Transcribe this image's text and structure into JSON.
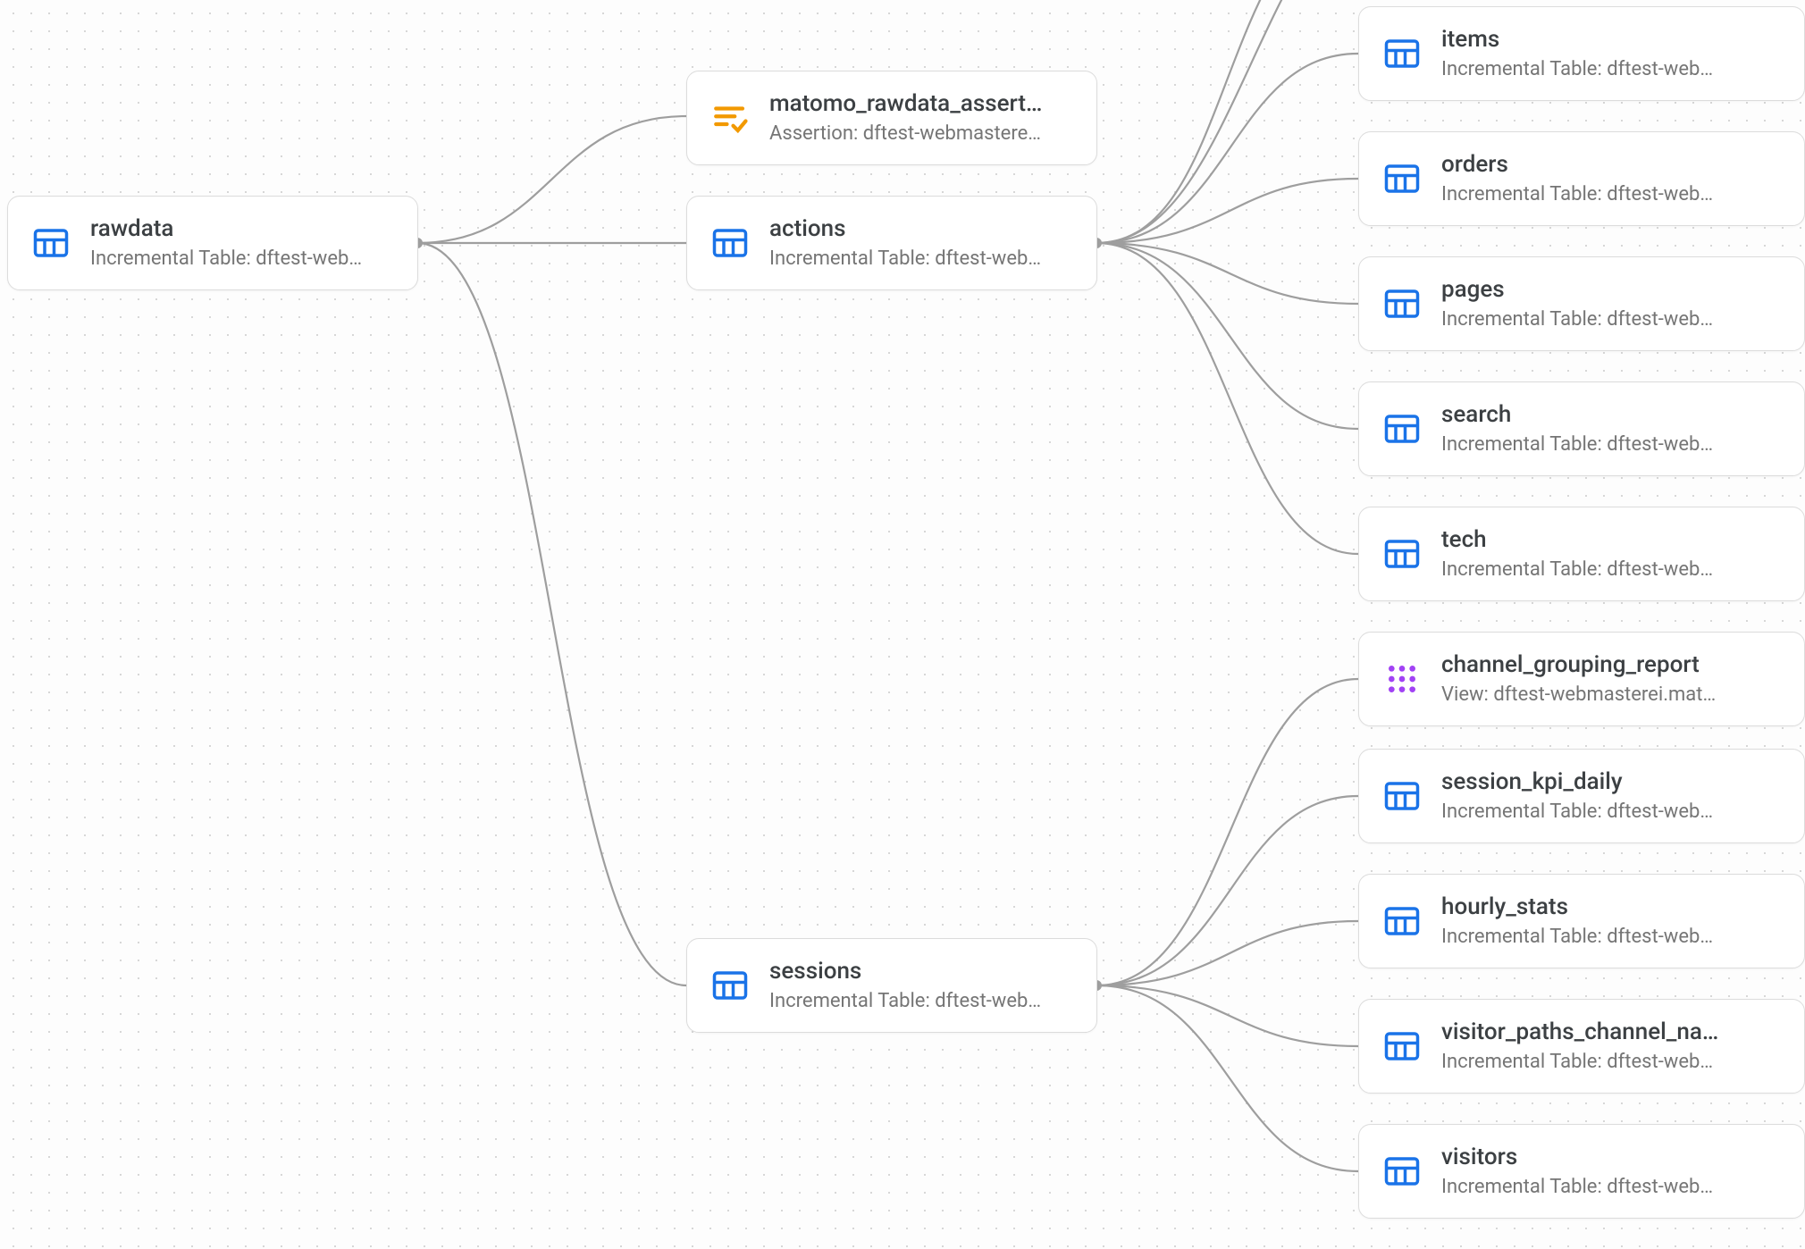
{
  "types": {
    "table": "Incremental Table: dftest-web…",
    "assertion": "Assertion: dftest-webmastere…",
    "view": "View: dftest-webmasterei.mat…"
  },
  "nodes": {
    "rawdata": {
      "title": "rawdata",
      "subtitleKey": "table"
    },
    "assert": {
      "title": "matomo_rawdata_assert…",
      "subtitleKey": "assertion"
    },
    "actions": {
      "title": "actions",
      "subtitleKey": "table"
    },
    "sessions": {
      "title": "sessions",
      "subtitleKey": "table"
    },
    "items": {
      "title": "items",
      "subtitleKey": "table"
    },
    "orders": {
      "title": "orders",
      "subtitleKey": "table"
    },
    "pages": {
      "title": "pages",
      "subtitleKey": "table"
    },
    "search": {
      "title": "search",
      "subtitleKey": "table"
    },
    "tech": {
      "title": "tech",
      "subtitleKey": "table"
    },
    "channel": {
      "title": "channel_grouping_report",
      "subtitleKey": "view"
    },
    "kpi": {
      "title": "session_kpi_daily",
      "subtitleKey": "table"
    },
    "hourly": {
      "title": "hourly_stats",
      "subtitleKey": "table"
    },
    "visitorp": {
      "title": "visitor_paths_channel_na…",
      "subtitleKey": "table"
    },
    "visitors": {
      "title": "visitors",
      "subtitleKey": "table"
    }
  }
}
